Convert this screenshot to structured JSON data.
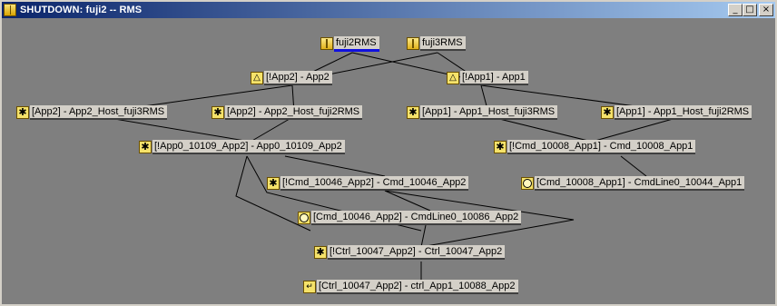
{
  "window": {
    "title": "SHUTDOWN: fuji2 -- RMS",
    "buttons": {
      "minimize": "_",
      "maximize": "□",
      "close": "×"
    }
  },
  "graph": {
    "nodes": [
      {
        "id": "fuji2",
        "label": "fuji2RMS",
        "icon": "userapp",
        "selected": true
      },
      {
        "id": "fuji3",
        "label": "fuji3RMS",
        "icon": "userapp"
      },
      {
        "id": "app2",
        "label": "[!App2]  -  App2",
        "icon": "app-icon",
        "glyph": "△"
      },
      {
        "id": "app1",
        "label": "[!App1]  -  App1",
        "icon": "app-icon",
        "glyph": "△"
      },
      {
        "id": "app2h3",
        "label": "[App2]  -  App2_Host_fuji3RMS",
        "icon": "gear-icon",
        "glyph": "✱"
      },
      {
        "id": "app2h2",
        "label": "[App2]  -  App2_Host_fuji2RMS",
        "icon": "gear-icon",
        "glyph": "✱"
      },
      {
        "id": "app1h3",
        "label": "[App1]  -  App1_Host_fuji3RMS",
        "icon": "gear-icon",
        "glyph": "✱"
      },
      {
        "id": "app1h2",
        "label": "[App1]  -  App1_Host_fuji2RMS",
        "icon": "gear-icon",
        "glyph": "✱"
      },
      {
        "id": "app0",
        "label": "[!App0_10109_App2]  -  App0_10109_App2",
        "icon": "gear-icon",
        "glyph": "✱"
      },
      {
        "id": "cmd08",
        "label": "[!Cmd_10008_App1]  -  Cmd_10008_App1",
        "icon": "gear-icon",
        "glyph": "✱"
      },
      {
        "id": "cmd46",
        "label": "[!Cmd_10046_App2]  -  Cmd_10046_App2",
        "icon": "gear-icon",
        "glyph": "✱"
      },
      {
        "id": "cl44",
        "label": "[Cmd_10008_App1]  -  CmdLine0_10044_App1",
        "icon": "circle-icon"
      },
      {
        "id": "cl86",
        "label": "[Cmd_10046_App2]  -  CmdLine0_10086_App2",
        "icon": "circle-icon"
      },
      {
        "id": "ctrl47",
        "label": "[!Ctrl_10047_App2]  -  Ctrl_10047_App2",
        "icon": "gear-icon",
        "glyph": "✱"
      },
      {
        "id": "ctrlapp1",
        "label": "[Ctrl_10047_App2]  -  ctrl_App1_10088_App2",
        "icon": "controller-icon",
        "glyph": "↵"
      }
    ]
  }
}
